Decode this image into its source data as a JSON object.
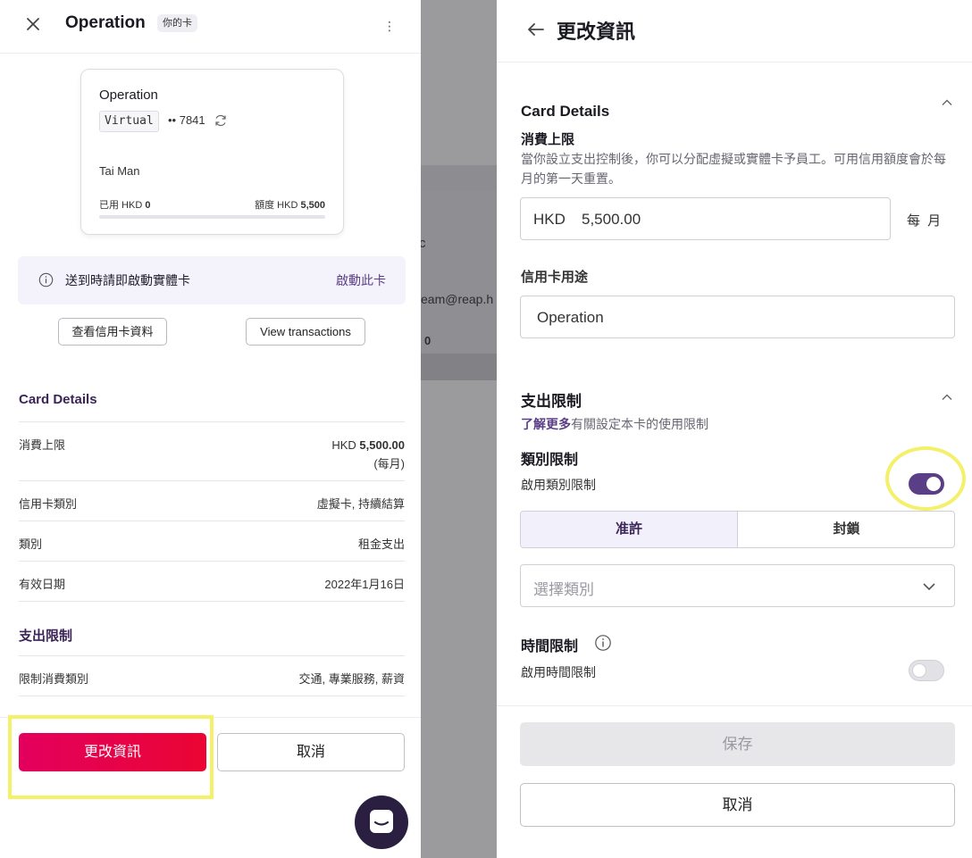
{
  "left": {
    "title": "Operation",
    "badge": "你的卡",
    "card": {
      "name": "Operation",
      "type_tag": "Virtual",
      "number": "•• 7841",
      "holder": "Tai Man",
      "used_label": "已用 HKD",
      "used_value": "0",
      "limit_label": "額度 HKD",
      "limit_value": "5,500",
      "progress": 0
    },
    "notice": {
      "text": "送到時請即啟動實體卡",
      "link": "啟動此卡"
    },
    "btn_view_card": "查看信用卡資料",
    "btn_view_tx": "View transactions",
    "details_title": "Card Details",
    "details": [
      {
        "label": "消費上限",
        "prefix": "HKD ",
        "value": "5,500.00",
        "sub": "(每月)"
      },
      {
        "label": "信用卡類別",
        "value": "虛擬卡, 持續結算"
      },
      {
        "label": "類別",
        "value": "租金支出"
      },
      {
        "label": "有效日期",
        "value": "2022年1月16日"
      }
    ],
    "limits_title": "支出限制",
    "limits": [
      {
        "label": "限制消費類別",
        "value": "交通, 專業服務, 薪資"
      }
    ],
    "edit_button": "更改資訊",
    "cancel_button": "取消"
  },
  "background": {
    "frag1": "c",
    "frag2": "eam@reap.h",
    "frag3": "0"
  },
  "right": {
    "title": "更改資訊",
    "card_details_title": "Card Details",
    "spend_limit_label": "消費上限",
    "spend_limit_desc": "當你設立支出控制後，你可以分配虛擬或實體卡予員工。可用信用額度會於每月的第一天重置。",
    "currency": "HKD",
    "amount": "5,500.00",
    "period": "每 月",
    "purpose_label": "信用卡用途",
    "purpose_value": "Operation",
    "spending_title": "支出限制",
    "learn_link": "了解更多",
    "learn_text": "有關設定本卡的使用限制",
    "category_title": "類別限制",
    "category_toggle_label": "啟用類別限制",
    "category_toggle_on": true,
    "allow_tab": "准許",
    "block_tab": "封鎖",
    "category_placeholder": "選擇類別",
    "time_title": "時間限制",
    "time_toggle_label": "啟用時間限制",
    "time_toggle_on": false,
    "save_button": "保存",
    "cancel_button": "取消"
  },
  "colors": {
    "brand": "#5b3f86",
    "primary_start": "#e3005d",
    "primary_end": "#ea0533",
    "highlight": "#f4f06a"
  },
  "icons": [
    "close-icon",
    "kebab-icon",
    "refresh-icon",
    "info-icon",
    "back-arrow-icon",
    "chevron-up-icon",
    "chevron-down-icon",
    "chat-icon"
  ]
}
